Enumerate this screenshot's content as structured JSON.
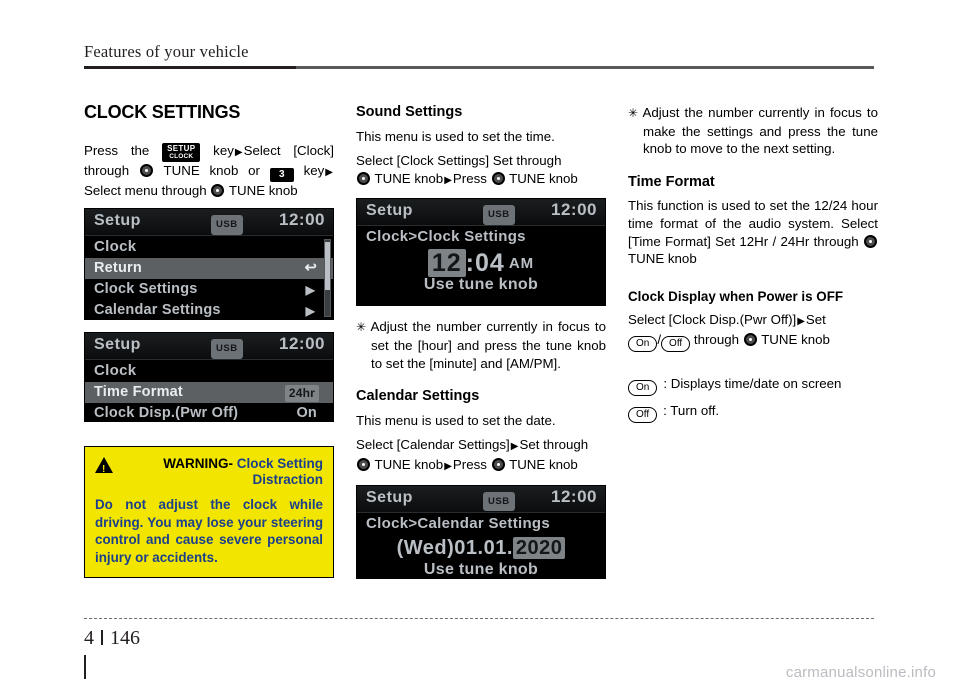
{
  "header": {
    "title": "Features of your vehicle"
  },
  "footer": {
    "chapter": "4",
    "page": "146",
    "watermark": "carmanualsonline.info"
  },
  "col1": {
    "section_title": "CLOCK SETTINGS",
    "intro_1": "Press the",
    "intro_setup_line1": "SETUP",
    "intro_setup_line2": "CLOCK",
    "intro_2": "key",
    "intro_3": "Select [Clock] through",
    "intro_4": "TUNE knob or",
    "intro_key3": "3",
    "intro_5": "key",
    "intro_6": "Select menu through",
    "intro_7": "TUNE knob",
    "lcd1": {
      "title": "Setup",
      "usb": "USB",
      "clock": "12:00",
      "subtitle": "Clock",
      "rows": [
        {
          "label": "Return",
          "right": "↩",
          "highlight": true
        },
        {
          "label": "Clock Settings",
          "chev": "▶",
          "highlight": false
        },
        {
          "label": "Calendar Settings",
          "chev": "▶",
          "highlight": false
        }
      ]
    },
    "lcd2": {
      "title": "Setup",
      "usb": "USB",
      "clock": "12:00",
      "subtitle": "Clock",
      "rows": [
        {
          "label": "Time Format",
          "badge": "24hr",
          "highlight": true
        },
        {
          "label": "Clock Disp.(Pwr Off)",
          "right": "On",
          "highlight": false
        }
      ]
    },
    "warning": {
      "label": "WARNING",
      "dash": "-",
      "title_line1": "Clock Setting",
      "title_line2": "Distraction",
      "body": "Do not adjust the clock while driving. You may lose your steering control and cause severe personal injury or accidents."
    }
  },
  "col2": {
    "sound_heading": "Sound Settings",
    "sound_p1": "This menu is used to set the time.",
    "sound_p2_a": "Select [Clock Settings] Set through",
    "sound_p2_b": "TUNE knob",
    "sound_p2_c": "Press",
    "sound_p2_d": "TUNE knob",
    "lcd3": {
      "title": "Setup",
      "usb": "USB",
      "clock": "12:00",
      "breadcrumb": "Clock>Clock Settings",
      "hours": "12",
      "colon": ":",
      "minutes": "04",
      "ampm": "AM",
      "hint": "Use tune knob"
    },
    "note_mark": "✳",
    "note_text": "Adjust the number currently in focus to set the [hour] and press the tune knob to set the [minute] and [AM/PM].",
    "calendar_heading": "Calendar Settings",
    "calendar_p1": "This menu is used to set the date.",
    "calendar_p2_a": "Select [Calendar Settings]",
    "calendar_p2_b": "Set through",
    "calendar_p2_c": "TUNE knob",
    "calendar_p2_d": "Press",
    "calendar_p2_e": "TUNE knob",
    "lcd4": {
      "title": "Setup",
      "usb": "USB",
      "clock": "12:00",
      "breadcrumb": "Clock>Calendar Settings",
      "date_prefix": "(Wed)01.01.",
      "date_year": "2020",
      "hint": "Use tune knob"
    }
  },
  "col3": {
    "note_mark": "✳",
    "note_text": "Adjust the number currently in focus to make the settings and press the tune knob to move to the next setting.",
    "time_format_heading": "Time Format",
    "time_format_p1_a": "This function is used to set the 12/24 hour time format of the audio system. Select [Time Format] Set 12Hr / 24Hr through",
    "time_format_p1_b": "TUNE knob",
    "clock_display_heading": "Clock Display when Power is OFF",
    "clock_display_p_a": "Select [Clock Disp.(Pwr Off)]",
    "clock_display_p_b": "Set",
    "pill_on": "On",
    "pill_slash": "/",
    "pill_off": "Off",
    "clock_display_p_c": "through",
    "clock_display_p_d": "TUNE knob",
    "legend": [
      {
        "pill": "On",
        "text": ": Displays time/date on screen"
      },
      {
        "pill": "Off",
        "text": ": Turn off."
      }
    ]
  }
}
